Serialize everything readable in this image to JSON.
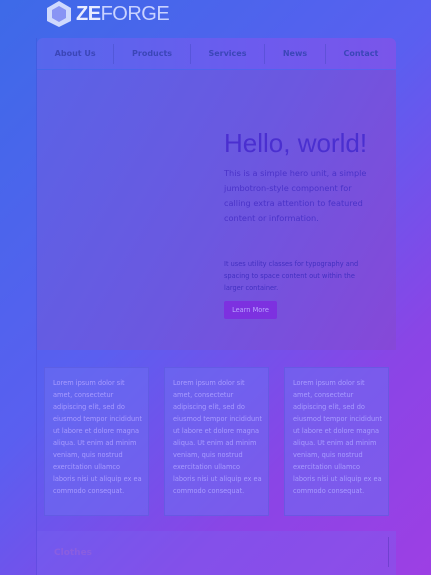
{
  "brand": {
    "prefix": "ZE",
    "suffix": "FORGE",
    "logo_icon": "hexagon-logo-icon"
  },
  "nav": {
    "items": [
      {
        "label": "About Us"
      },
      {
        "label": "Products"
      },
      {
        "label": "Services"
      },
      {
        "label": "News"
      },
      {
        "label": "Contact"
      }
    ]
  },
  "hero": {
    "heading": "Hello, world!",
    "lead": "This is a simple hero unit, a simple jumbotron-style component for calling extra attention to featured content or information.",
    "body": "It uses utility classes for typography and spacing to space content out within the larger container.",
    "button_label": "Learn More"
  },
  "cards": [
    {
      "text": "Lorem ipsum dolor sit amet, consectetur adipiscing elit, sed do eiusmod tempor incididunt ut labore et dolore magna aliqua. Ut enim ad minim veniam, quis nostrud exercitation ullamco laboris nisi ut aliquip ex ea commodo consequat."
    },
    {
      "text": "Lorem ipsum dolor sit amet, consectetur adipiscing elit, sed do eiusmod tempor incididunt ut labore et dolore magna aliqua. Ut enim ad minim veniam, quis nostrud exercitation ullamco laboris nisi ut aliquip ex ea commodo consequat."
    },
    {
      "text": "Lorem ipsum dolor sit amet, consectetur adipiscing elit, sed do eiusmod tempor incididunt ut labore et dolore magna aliqua. Ut enim ad minim veniam, quis nostrud exercitation ullamco laboris nisi ut aliquip ex ea commodo consequat."
    }
  ],
  "footer": {
    "label": "Clothes"
  },
  "colors": {
    "accent": "#7d31e0",
    "background_start": "#3d6ae8",
    "background_end": "#9d3fe4"
  }
}
